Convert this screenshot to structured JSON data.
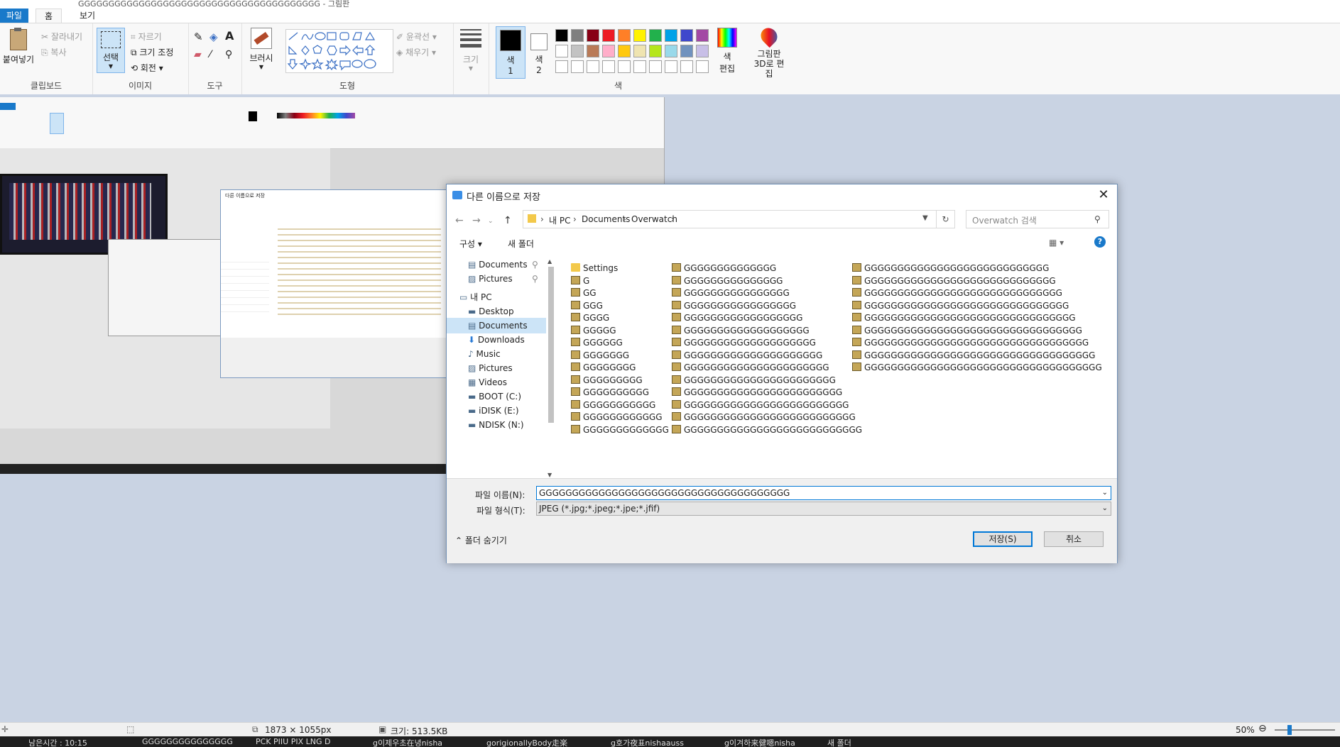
{
  "window": {
    "title": "GGGGGGGGGGGGGGGGGGGGGGGGGGGGGGGGGGGGGGGG - 그림판"
  },
  "ribbon_tabs": [
    "파일",
    "홈",
    "보기"
  ],
  "ribbon": {
    "clipboard": {
      "paste": "붙여넣기",
      "cut": "잘라내기",
      "copy": "복사",
      "label": "클립보드"
    },
    "image": {
      "select": "선택",
      "crop": "자르기",
      "resize": "크기 조정",
      "rotate": "회전",
      "label": "이미지"
    },
    "tools": {
      "label": "도구"
    },
    "shapes": {
      "brushes": "브러시",
      "outline": "윤곽선",
      "fill": "채우기",
      "label": "도형"
    },
    "size": {
      "label": "크기"
    },
    "colors": {
      "color1": "색",
      "color1_num": "1",
      "color2": "색",
      "color2_num": "2",
      "edit_colors": "색 편집",
      "paint3d": "그림판 3D로 편집",
      "label": "색"
    },
    "palette_row1": [
      "#000000",
      "#7f7f7f",
      "#880015",
      "#ed1c24",
      "#ff7f27",
      "#fff200",
      "#22b14c",
      "#00a2e8",
      "#3f48cc",
      "#a349a4"
    ],
    "palette_row2": [
      "#ffffff",
      "#c3c3c3",
      "#b97a57",
      "#ffaec9",
      "#ffc90e",
      "#efe4b0",
      "#b5e61d",
      "#99d9ea",
      "#7092be",
      "#c8bfe7"
    ]
  },
  "dialog": {
    "title": "다른 이름으로 저장",
    "breadcrumb": [
      "내 PC",
      "Documents",
      "Overwatch"
    ],
    "search_placeholder": "Overwatch 검색",
    "organize": "구성",
    "new_folder": "새 폴더",
    "nav_items": [
      {
        "label": "Documents",
        "icon": "documents-icon",
        "pinned": true
      },
      {
        "label": "Pictures",
        "icon": "pictures-icon",
        "pinned": true
      },
      {
        "label": "내 PC",
        "icon": "pc-icon"
      },
      {
        "label": "Desktop",
        "icon": "desktop-icon"
      },
      {
        "label": "Documents",
        "icon": "documents-icon",
        "selected": true
      },
      {
        "label": "Downloads",
        "icon": "downloads-icon"
      },
      {
        "label": "Music",
        "icon": "music-icon"
      },
      {
        "label": "Pictures",
        "icon": "pictures-icon"
      },
      {
        "label": "Videos",
        "icon": "videos-icon"
      },
      {
        "label": "BOOT (C:)",
        "icon": "drive-icon"
      },
      {
        "label": "iDISK (E:)",
        "icon": "drive-icon"
      },
      {
        "label": "NDISK (N:)",
        "icon": "drive-icon"
      }
    ],
    "files_col1": [
      "Settings",
      "G",
      "GG",
      "GGG",
      "GGGG",
      "GGGGG",
      "GGGGGG",
      "GGGGGGG",
      "GGGGGGGG",
      "GGGGGGGGG",
      "GGGGGGGGGG",
      "GGGGGGGGGGG",
      "GGGGGGGGGGGG",
      "GGGGGGGGGGGGG"
    ],
    "files_col2": [
      "GGGGGGGGGGGGGG",
      "GGGGGGGGGGGGGGG",
      "GGGGGGGGGGGGGGGG",
      "GGGGGGGGGGGGGGGGG",
      "GGGGGGGGGGGGGGGGGG",
      "GGGGGGGGGGGGGGGGGGG",
      "GGGGGGGGGGGGGGGGGGGG",
      "GGGGGGGGGGGGGGGGGGGGG",
      "GGGGGGGGGGGGGGGGGGGGGG",
      "GGGGGGGGGGGGGGGGGGGGGGG",
      "GGGGGGGGGGGGGGGGGGGGGGGG",
      "GGGGGGGGGGGGGGGGGGGGGGGGG",
      "GGGGGGGGGGGGGGGGGGGGGGGGGG",
      "GGGGGGGGGGGGGGGGGGGGGGGGGGG"
    ],
    "files_col3": [
      "GGGGGGGGGGGGGGGGGGGGGGGGGGGG",
      "GGGGGGGGGGGGGGGGGGGGGGGGGGGGG",
      "GGGGGGGGGGGGGGGGGGGGGGGGGGGGGG",
      "GGGGGGGGGGGGGGGGGGGGGGGGGGGGGGG",
      "GGGGGGGGGGGGGGGGGGGGGGGGGGGGGGGG",
      "GGGGGGGGGGGGGGGGGGGGGGGGGGGGGGGGG",
      "GGGGGGGGGGGGGGGGGGGGGGGGGGGGGGGGGG",
      "GGGGGGGGGGGGGGGGGGGGGGGGGGGGGGGGGGG",
      "GGGGGGGGGGGGGGGGGGGGGGGGGGGGGGGGGGGG"
    ],
    "filename_label": "파일 이름(N):",
    "filename_value": "GGGGGGGGGGGGGGGGGGGGGGGGGGGGGGGGGGGGGG",
    "filetype_label": "파일 형식(T):",
    "filetype_value": "JPEG (*.jpg;*.jpeg;*.jpe;*.jfif)",
    "hide_folders": "폴더 숨기기",
    "save": "저장(S)",
    "cancel": "취소"
  },
  "status": {
    "dimensions": "1873 × 1055px",
    "size": "크기: 513.5KB",
    "zoom": "50%"
  },
  "taskbar": [
    "남은시간 : 10:15",
    "GGGGGGGGGGGGGGG",
    "PCK PIIU PIX LNG D",
    "g이제우초在녕nisha",
    "gorigionallyBody走楽",
    "g호가夜표nishaauss",
    "g이겨하来健嗯nisha",
    "새 폴더"
  ]
}
